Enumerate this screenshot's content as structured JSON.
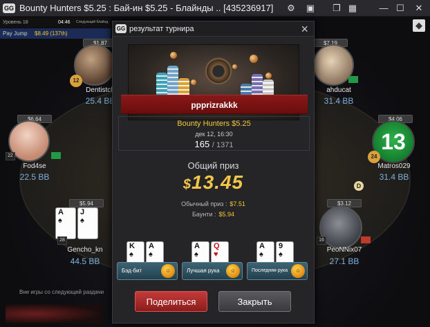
{
  "window": {
    "app_logo": "GG",
    "title": "Bounty Hunters $5.25 : Бай-ин $5.25 - Блайнды .. [435236917]",
    "icons": [
      "gear-icon",
      "layout-icon",
      "tile-icon",
      "grid-icon",
      "minimize-icon",
      "maximize-icon",
      "close-icon"
    ]
  },
  "info": {
    "level": "Уровень 18",
    "time": "04:46",
    "next": "Следующий блайнд",
    "pay_jump_label": "Pay Jump",
    "pay_jump_value": "$8.49 (137th)"
  },
  "players": [
    {
      "name": "Dentistch",
      "stack_top": "$1.87",
      "bb": "25.4 BB",
      "badge": "12"
    },
    {
      "name": "Fod4se",
      "stack_top": "$6.64",
      "bb": "22.5 BB",
      "seat": "22"
    },
    {
      "name": "Gencho_kn",
      "stack_top": "$5.94",
      "bb": "44.5 BB",
      "seat": "28"
    },
    {
      "name": "ahducat",
      "stack_top": "$7.19",
      "bb": "31.4 BB"
    },
    {
      "name": "Matros029",
      "stack_top": "$4.06",
      "bb": "31.4 BB",
      "badge": "24",
      "avatar_text": "13"
    },
    {
      "name": "PeoNNix07",
      "stack_top": "$3.12",
      "bb": "27.1 BB",
      "seat": "16"
    }
  ],
  "dealer_button": "D",
  "modal": {
    "logo": "GG",
    "title": "результат турнира",
    "close_icon": "close-icon",
    "winner_name": "pppriz​rakkk",
    "tournament_name": "Bounty Hunters $5.25",
    "date": "дек 12, 16:30",
    "place": "165",
    "total": "/ 1371",
    "total_prize_label": "Общий приз",
    "total_prize_currency": "$",
    "total_prize_amount": "13.45",
    "regular_prize_label": "Обычный приз :",
    "regular_prize_value": "$7.51",
    "bounty_label": "Баунти :",
    "bounty_value": "$5.94",
    "hands": [
      {
        "label": "Бэд-бит",
        "cards": [
          {
            "rank": "K",
            "suit": "♠",
            "red": false
          },
          {
            "rank": "A",
            "suit": "♠",
            "red": false
          }
        ]
      },
      {
        "label": "Лучшая рука",
        "cards": [
          {
            "rank": "A",
            "suit": "♠",
            "red": false
          },
          {
            "rank": "Q",
            "suit": "♥",
            "red": true
          }
        ]
      },
      {
        "label": "Последняя рука",
        "cards": [
          {
            "rank": "A",
            "suit": "♠",
            "red": false
          },
          {
            "rank": "9",
            "suit": "♠",
            "red": false
          }
        ]
      }
    ],
    "share_label": "Поделиться",
    "close_label": "Закрыть"
  },
  "footer": {
    "status": "Вне игры со следующей раздачи"
  }
}
